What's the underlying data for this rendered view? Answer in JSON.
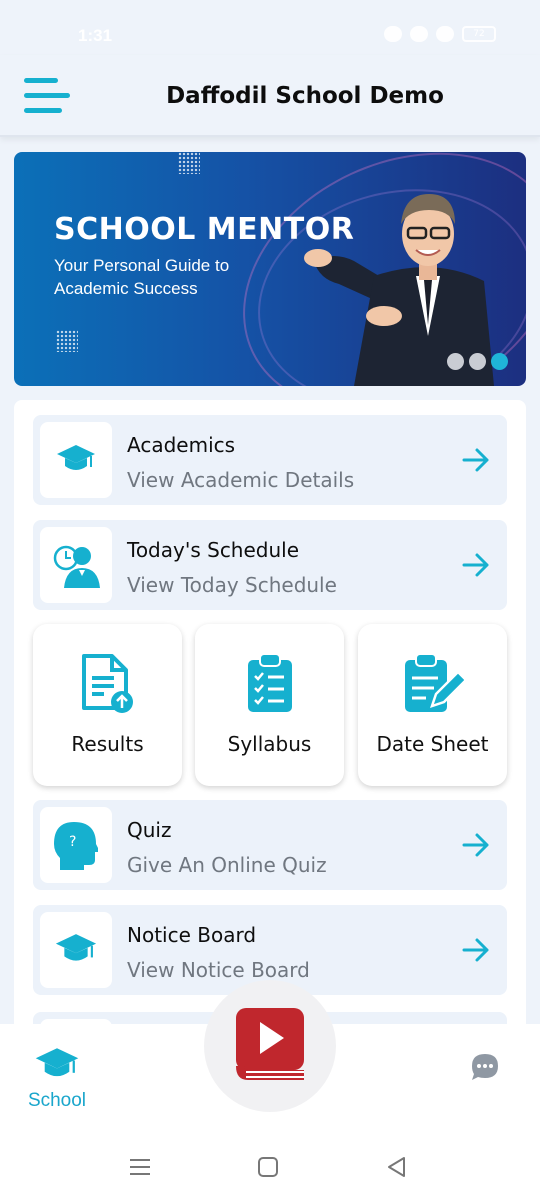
{
  "status_bar": {
    "time": "1:31",
    "battery": "72"
  },
  "app_bar": {
    "title": "Daffodil School Demo"
  },
  "banner": {
    "heading": "SCHOOL MENTOR",
    "subtitle": "Your Personal Guide to Academic Success",
    "slide_count": 3,
    "active_slide": 3
  },
  "menu_rows": [
    {
      "title": "Academics",
      "subtitle": "View Academic Details",
      "icon": "graduation-cap-icon"
    },
    {
      "title": "Today's Schedule",
      "subtitle": "View Today Schedule",
      "icon": "schedule-person-clock-icon"
    },
    {
      "title": "Quiz",
      "subtitle": "Give An Online Quiz",
      "icon": "head-question-icon"
    },
    {
      "title": "Notice Board",
      "subtitle": "View Notice Board",
      "icon": "graduation-cap-icon"
    }
  ],
  "tiles": [
    {
      "label": "Results",
      "icon": "document-upload-icon"
    },
    {
      "label": "Syllabus",
      "icon": "clipboard-checklist-icon"
    },
    {
      "label": "Date Sheet",
      "icon": "clipboard-edit-icon"
    }
  ],
  "bottom_nav": {
    "school_label": "School",
    "center_icon": "video-book-icon",
    "right_icon": "chat-bubble-icon"
  },
  "colors": {
    "accent": "#16b0cf",
    "card_bg": "#ecf2fa",
    "video_red": "#c0272d"
  }
}
